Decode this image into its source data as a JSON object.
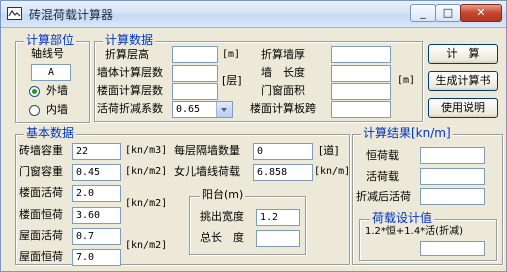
{
  "window": {
    "title": "砖混荷载计算器",
    "minimize_glyph": "_",
    "maximize_glyph": "□",
    "close_glyph": "✕",
    "icon": "app-icon"
  },
  "calc_part": {
    "title": "计算部位",
    "axis_label": "轴线号",
    "axis_value": "A",
    "radio_outer": "外墙",
    "radio_inner": "内墙",
    "selected": "外墙"
  },
  "calc_data": {
    "title": "计算数据",
    "floor_height_label": "折算层高",
    "floor_height_value": "",
    "floor_height_unit": "[m]",
    "wall_floors_label": "墙体计算层数",
    "wall_floors_value": "",
    "floor_calc_label": "楼面计算层数",
    "floor_calc_value": "",
    "floors_unit": "[层]",
    "live_factor_label": "活荷折减系数",
    "live_factor_value": "0.65",
    "wall_thickness_label": "折算墙厚",
    "wall_thickness_value": "",
    "wall_length_label": "墙　长度",
    "wall_length_value": "",
    "door_area_label": "门窗面积",
    "door_area_value": "",
    "slab_span_label": "楼面计算板跨",
    "slab_span_value": "",
    "right_unit": "[m]"
  },
  "buttons": {
    "calculate": "计　算",
    "generate_book": "生成计算书",
    "instructions": "使用说明"
  },
  "basic_data": {
    "title": "基本数据",
    "rows": [
      {
        "label": "砖墙容重",
        "value": "22",
        "unit": "[kn/m3]"
      },
      {
        "label": "门窗容重",
        "value": "0.45",
        "unit": "[kn/m2]"
      },
      {
        "label": "楼面活荷",
        "value": "2.0",
        "unit": ""
      },
      {
        "label": "楼面恒荷",
        "value": "3.60",
        "unit": "[kn/m2]"
      },
      {
        "label": "屋面活荷",
        "value": "0.7",
        "unit": ""
      },
      {
        "label": "屋面恒荷",
        "value": "7.0",
        "unit": "[kn/m2]"
      }
    ],
    "partition_label": "每层隔墙数量",
    "partition_value": "0",
    "partition_unit": "[道]",
    "parapet_label": "女儿墙线荷载",
    "parapet_value": "6.858",
    "parapet_unit": "[kn/m]",
    "balcony": {
      "title": "阳台(m)",
      "overhang_label": "挑出宽度",
      "overhang_value": "1.2",
      "length_label": "总长　度",
      "length_value": ""
    }
  },
  "result": {
    "title": "计算结果[kn/m]",
    "dead_label": "恒荷载",
    "dead_value": "",
    "live_label": "活荷载",
    "live_value": "",
    "reduced_label": "折减后活荷",
    "reduced_value": "",
    "design": {
      "title": "荷载设计值",
      "formula": "1.2*恒+1.4*活(折减)",
      "value": ""
    }
  }
}
